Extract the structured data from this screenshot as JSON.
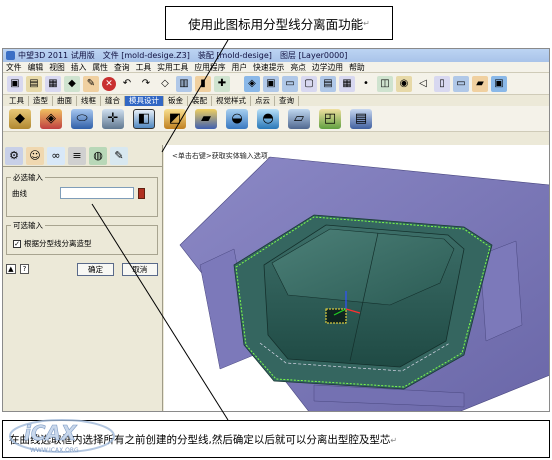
{
  "annotation_top": "使用此图标用分型线分离面功能",
  "annotation_bottom": "在曲线选取框内选择所有之前创建的分型线,然后确定以后就可以分离出型腔及型芯",
  "return_mark": "↵",
  "logo_text": "iCAX",
  "logo_url": "WWW.ICAX.ORG",
  "window": {
    "app_name": "中望3D 2011 试用版",
    "file": "文件 [mold-desige.Z3]",
    "assembly": "装配 [mold-desige]",
    "layer": "图层 [Layer0000]"
  },
  "menu": [
    "文件",
    "编辑",
    "视图",
    "插入",
    "属性",
    "查询",
    "工具",
    "实用工具",
    "应用程序",
    "用户",
    "快速提示",
    "亮点",
    "边学边用",
    "帮助"
  ],
  "tabs": [
    "工具",
    "造型",
    "曲面",
    "线框",
    "缝合",
    "模具设计",
    "钣金",
    "装配",
    "视觉样式",
    "点云",
    "查询"
  ],
  "active_tab": "模具设计",
  "panel": {
    "required_group": "必选输入",
    "curve_label": "曲线",
    "optional_group": "可选输入",
    "checkbox_label": "根据分型线分离造型",
    "checkbox_checked": true,
    "ok_label": "确定",
    "cancel_label": "取消"
  },
  "viewport_hint": "<单击右键>获取实体输入选项.",
  "colors": {
    "title_bar": "#a9c3e9",
    "active_tab": "#3167c4",
    "part_surface": "#7a77b8",
    "mold_core": "#2f5f58",
    "panel_bg": "#ece9d8"
  }
}
